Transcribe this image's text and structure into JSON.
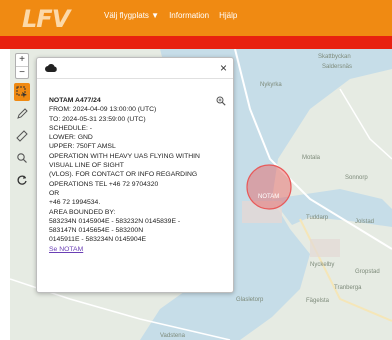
{
  "header": {
    "logo_text": "LFV",
    "nav": [
      "Välj flygplats ▼",
      "Information",
      "Hjälp"
    ]
  },
  "map": {
    "places": [
      "Skattbyckan",
      "Saldersnäs",
      "Nykyrka",
      "Motala",
      "Sonnorp",
      "Tuddarp",
      "Jolstad",
      "Nyckelby",
      "Gropstad",
      "Tranberga",
      "Glasletorp",
      "Fägelsta",
      "Vadstena"
    ],
    "zone_label": "NOTAM"
  },
  "toolbar": {
    "zoom_in": "+",
    "zoom_out": "−"
  },
  "popup": {
    "close": "×",
    "lines": [
      "NOTAM A477/24",
      "FROM: 2024-04-09 13:00:00 (UTC)",
      "TO: 2024-05-31 23:59:00 (UTC)",
      "SCHEDULE: -",
      "LOWER: GND",
      "UPPER: 750FT AMSL",
      "OPERATION WITH HEAVY UAS FLYING WITHIN",
      "VISUAL LINE OF SIGHT",
      "(VLOS). FOR CONTACT OR INFO REGARDING",
      "OPERATIONS TEL +46 72 9704320",
      "OR",
      "+46 72 1994534.",
      "AREA BOUNDED BY:",
      "583234N 0145904E - 583232N 0145839E -",
      "583147N 0145654E - 583200N",
      "0145911E - 583234N 0145904E"
    ],
    "link": "Se NOTAM"
  },
  "colors": {
    "header": "#f08a12",
    "redbar": "#e8210f",
    "zone": "#e85a5a"
  }
}
